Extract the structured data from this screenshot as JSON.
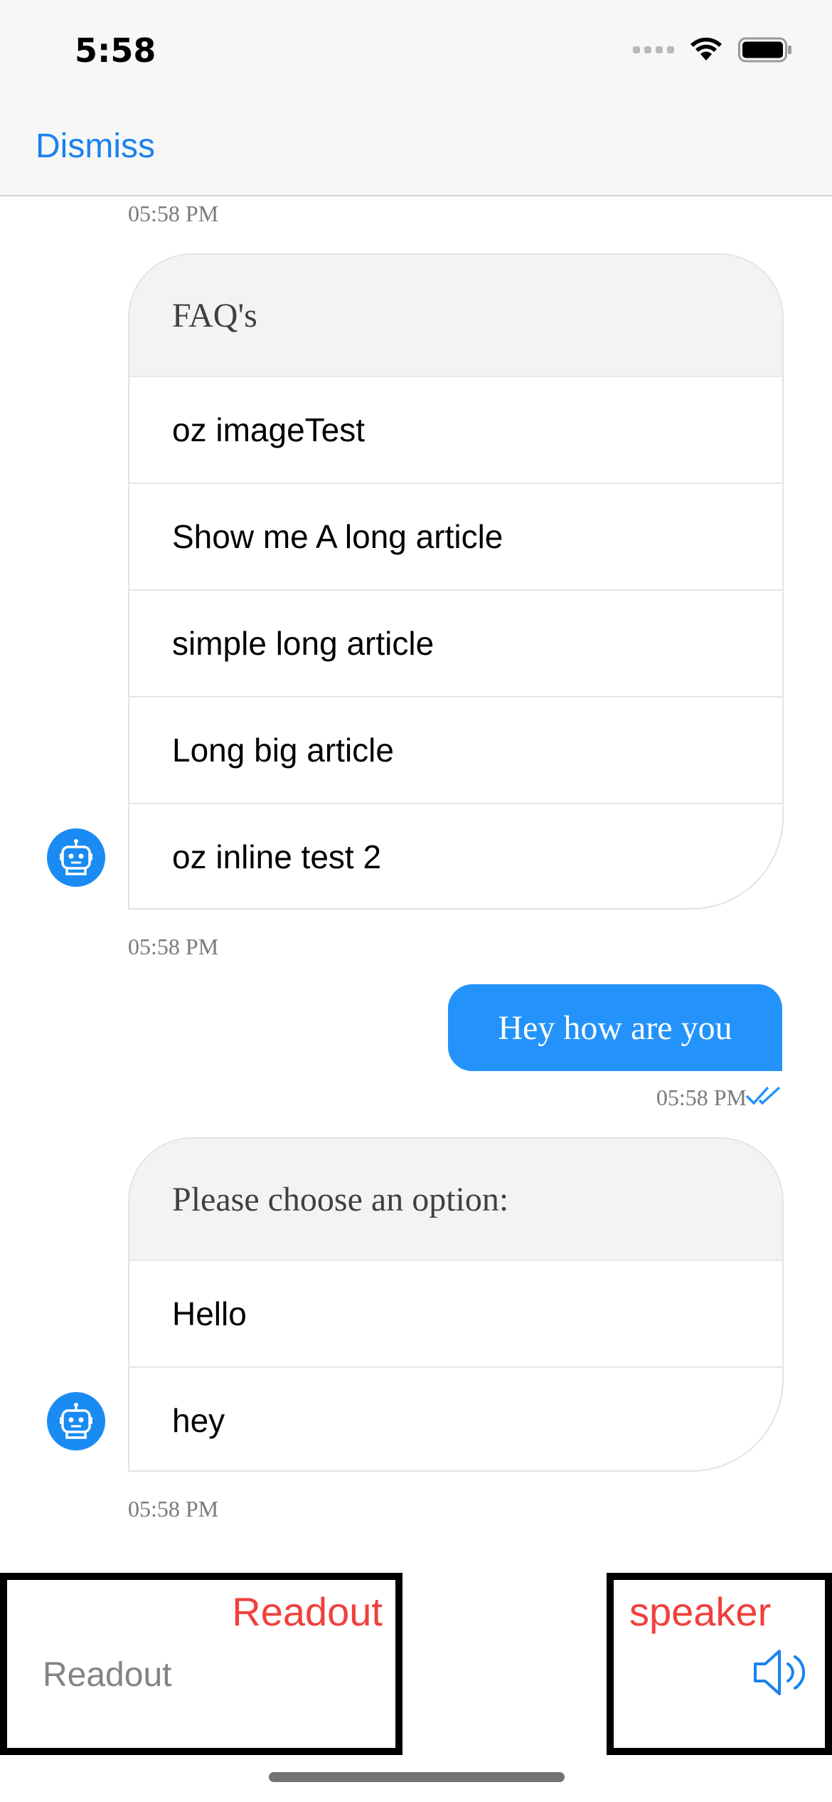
{
  "status_bar": {
    "time": "5:58",
    "icons": [
      "signal-icon",
      "wifi-icon",
      "battery-icon"
    ]
  },
  "nav": {
    "dismiss_label": "Dismiss"
  },
  "chat": {
    "messages": [
      {
        "sender": "bot",
        "timestamp_above": "05:58 PM",
        "header": "FAQ's",
        "options": [
          "oz imageTest",
          "Show me A long article",
          "simple long article",
          "Long big article",
          "oz inline test 2"
        ],
        "timestamp": "05:58 PM"
      },
      {
        "sender": "user",
        "text": "Hey how are you",
        "timestamp": "05:58 PM",
        "read_icon": "double-check-icon"
      },
      {
        "sender": "bot",
        "header": "Please choose an option:",
        "options": [
          "Hello",
          "hey"
        ],
        "timestamp": "05:58 PM"
      }
    ]
  },
  "bottom": {
    "readout_tag": "Readout",
    "readout_placeholder": "Readout",
    "speaker_tag": "speaker",
    "speaker_icon": "speaker-icon"
  },
  "colors": {
    "accent": "#1a82ee",
    "user_bubble": "#2393fb",
    "avatar": "#1a8bf2",
    "annotation_red": "#f0403c",
    "annotation_border": "#000000"
  }
}
